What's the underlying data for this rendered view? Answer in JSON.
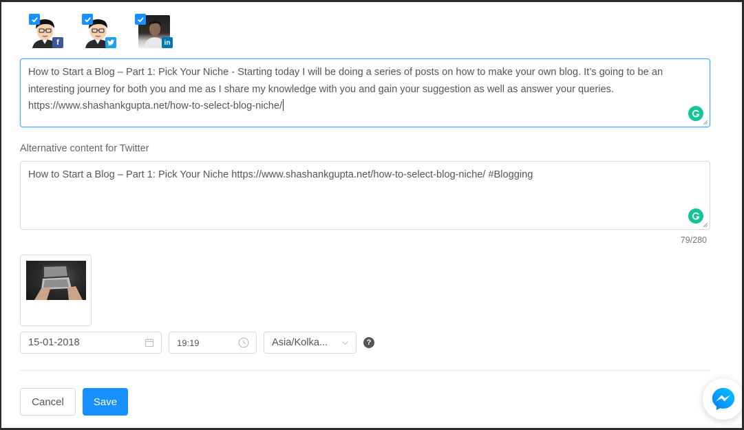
{
  "accounts": [
    {
      "network": "facebook",
      "badge": "f",
      "checked": true,
      "avatar": "cartoon-avatar"
    },
    {
      "network": "twitter",
      "badge": "twitter-bird-icon",
      "checked": true,
      "avatar": "cartoon-avatar"
    },
    {
      "network": "linkedin",
      "badge": "in",
      "checked": true,
      "avatar": "photo-avatar"
    }
  ],
  "main_post": {
    "value": "How to Start a Blog – Part 1: Pick Your Niche - Starting today I will be doing a series of posts on how to make your own blog. It’s going to be an interesting journey for both you and me as I share my knowledge with you and gain your suggestion as well as answer your queries. https://www.shashankgupta.net/how-to-select-blog-niche/"
  },
  "twitter_alt": {
    "label": "Alternative content for Twitter",
    "value": "How to Start a Blog – Part 1: Pick Your Niche https://www.shashankgupta.net/how-to-select-blog-niche/ #Blogging",
    "counter": "79/280"
  },
  "schedule": {
    "date": "15-01-2018",
    "time": "19:19",
    "timezone": "Asia/Kolka..."
  },
  "buttons": {
    "cancel": "Cancel",
    "save": "Save"
  },
  "colors": {
    "primary": "#1890ff",
    "facebook": "#3b5998",
    "twitter": "#1da1f2",
    "linkedin": "#0077b5",
    "grammarly": "#15c39a"
  }
}
